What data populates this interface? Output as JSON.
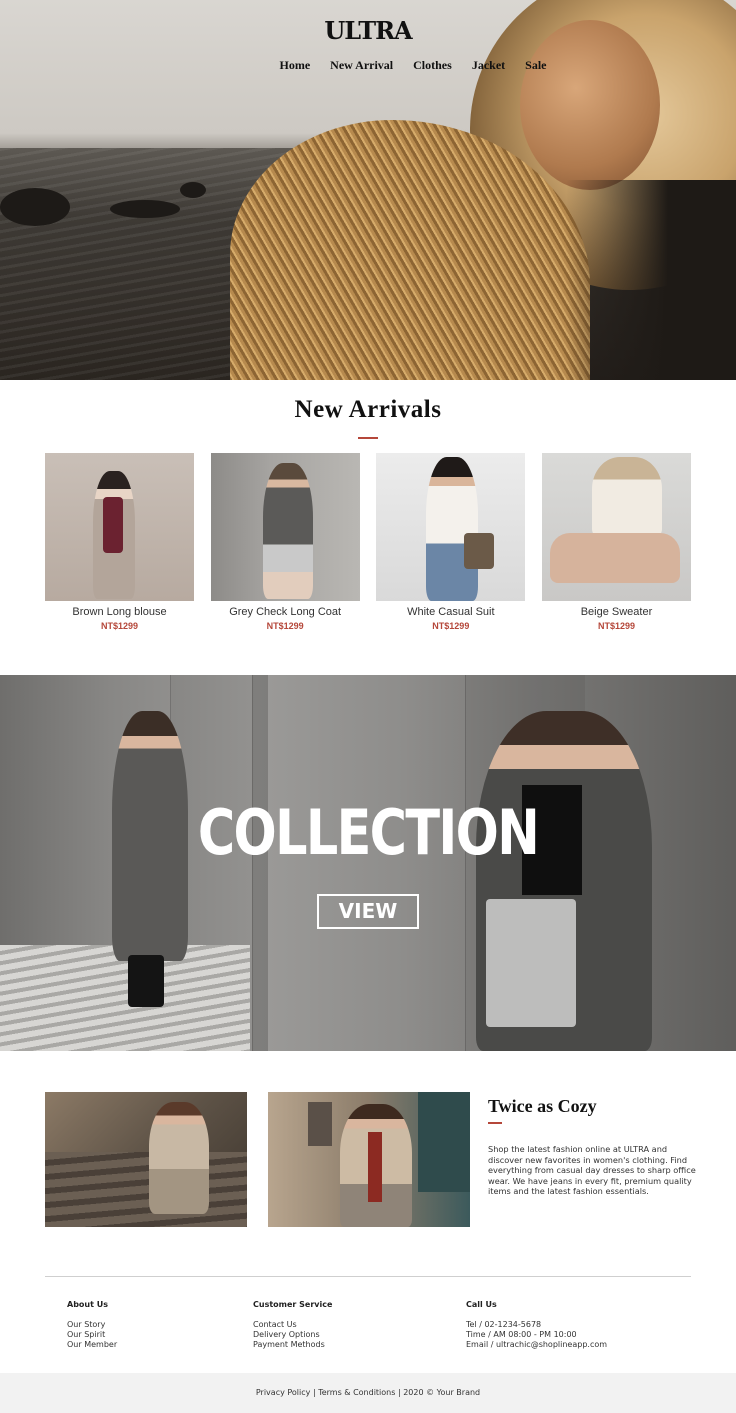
{
  "brand": {
    "logo": "ULTRA"
  },
  "nav": {
    "items": [
      "Home",
      "New Arrival",
      "Clothes",
      "Jacket",
      "Sale"
    ]
  },
  "new_arrivals": {
    "title": "New Arrivals",
    "products": [
      {
        "name": "Brown Long blouse",
        "price": "NT$1299"
      },
      {
        "name": "Grey Check Long Coat",
        "price": "NT$1299"
      },
      {
        "name": "White Casual Suit",
        "price": "NT$1299"
      },
      {
        "name": "Beige Sweater",
        "price": "NT$1299"
      }
    ]
  },
  "collection": {
    "title": "COLLECTION",
    "button": "VIEW"
  },
  "cozy": {
    "title": "Twice as Cozy",
    "text": "Shop the latest fashion online at ULTRA and discover new favorites in women's clothing. Find everything from casual day dresses to sharp office wear. We have jeans in every fit, premium quality items and the latest fashion essentials."
  },
  "footer": {
    "about": {
      "title": "About Us",
      "links": [
        "Our Story",
        "Our Spirit",
        "Our Member"
      ]
    },
    "service": {
      "title": "Customer Service",
      "links": [
        "Contact Us",
        "Delivery Options",
        "Payment Methods"
      ]
    },
    "call": {
      "title": "Call Us",
      "lines": [
        "Tel / 02-1234-5678",
        "Time / AM 08:00 - PM 10:00",
        "Email / ultrachic@shoplineapp.com"
      ]
    },
    "bottom": {
      "privacy": "Privacy Policy",
      "terms": "Terms & Conditions",
      "copyright": "2020 © Your Brand"
    }
  },
  "colors": {
    "accent": "#b5473a",
    "text": "#222222",
    "footer_bg": "#f2f2f2"
  }
}
